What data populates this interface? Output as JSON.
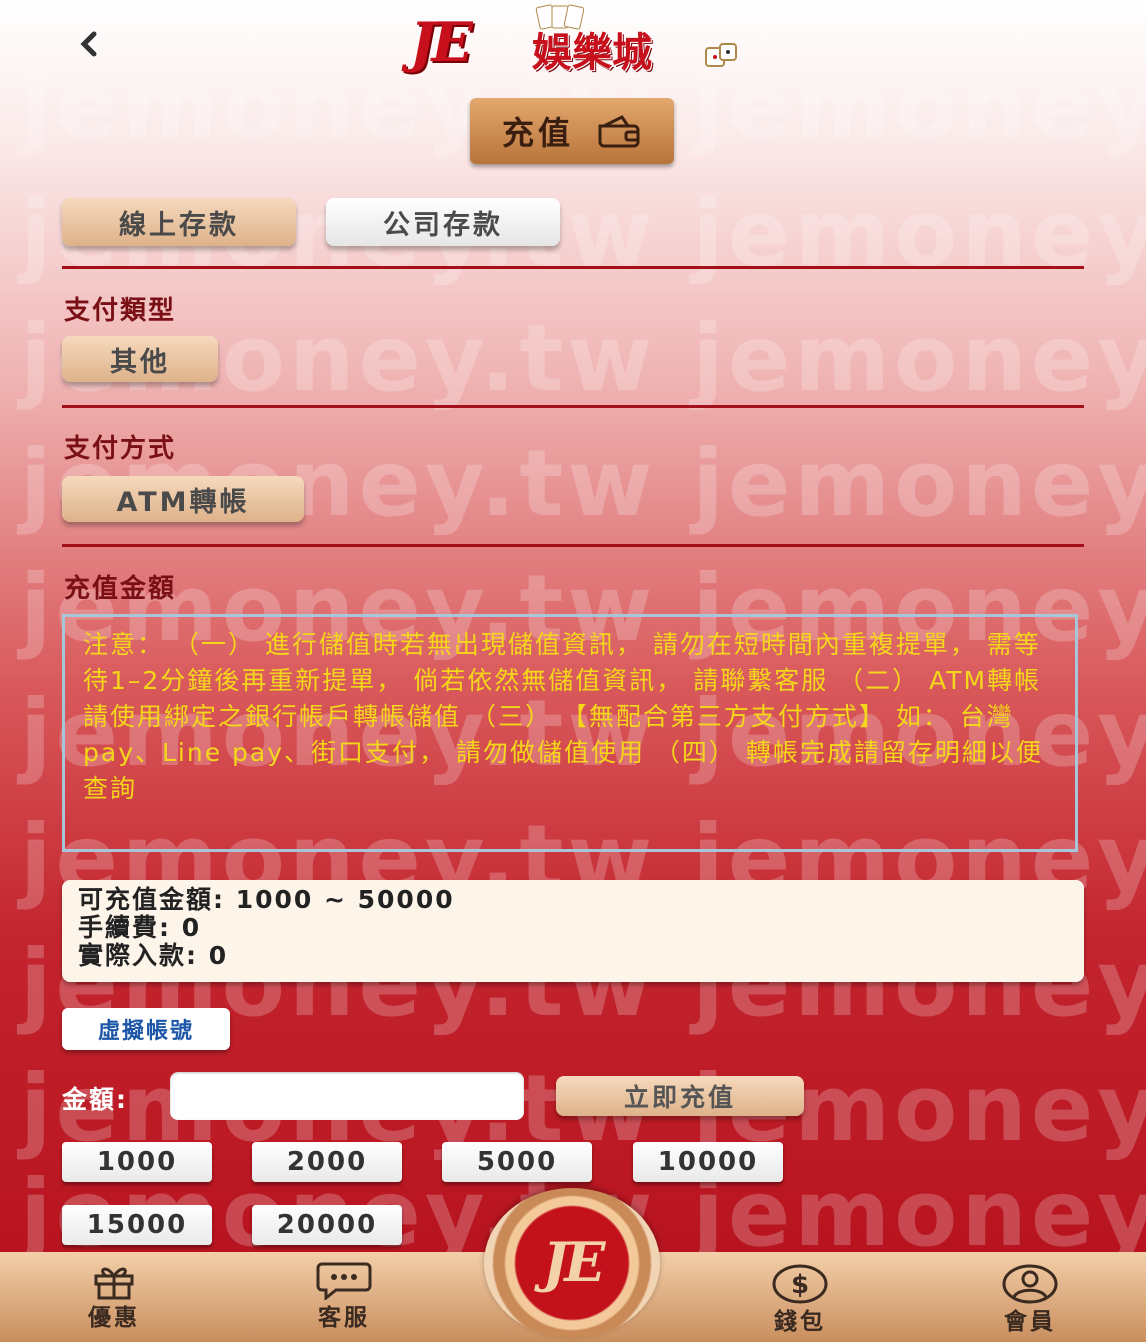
{
  "header": {
    "back_icon": "chevron-left-icon",
    "logo_mark": "JE",
    "logo_name": "娛樂城",
    "title": "充值",
    "title_icon": "wallet-icon"
  },
  "deposit_tabs": [
    {
      "label": "線上存款",
      "active": true
    },
    {
      "label": "公司存款",
      "active": false
    }
  ],
  "payment_type": {
    "label": "支付類型",
    "option": "其他"
  },
  "payment_method": {
    "label": "支付方式",
    "option": "ATM轉帳"
  },
  "recharge": {
    "label": "充值金額",
    "notice": "注意： （一） 進行儲值時若無出現儲值資訊， 請勿在短時間內重複提單， 需等待1–2分鐘後再重新提單， 倘若依然無儲值資訊， 請聯繫客服 （二） ATM轉帳請使用綁定之銀行帳戶轉帳儲值 （三） 【無配合第三方支付方式】 如： 台灣pay、Line pay、街口支付， 請勿做儲值使用 （四） 轉帳完成請留存明細以便查詢",
    "range_text": "可充值金額: 1000 ~ 50000",
    "fee_text": "手續費: 0",
    "actual_text": "實際入款: 0",
    "virtual_account_button": "虛擬帳號",
    "amount_label": "金額:",
    "amount_value": "",
    "submit_button": "立即充值",
    "quick_amounts": [
      "1000",
      "2000",
      "5000",
      "10000",
      "15000",
      "20000"
    ]
  },
  "watermark": "jemoney.tw",
  "tabbar": [
    {
      "label": "優惠",
      "icon": "gift-icon"
    },
    {
      "label": "客服",
      "icon": "chat-bubble-icon"
    },
    {
      "label": "",
      "icon": "je-logo-icon"
    },
    {
      "label": "錢包",
      "icon": "dollar-coin-icon"
    },
    {
      "label": "會員",
      "icon": "user-icon"
    }
  ],
  "colors": {
    "accent": "#a3101c",
    "notice_text": "#f4d61a",
    "link_blue": "#1e57a8"
  }
}
